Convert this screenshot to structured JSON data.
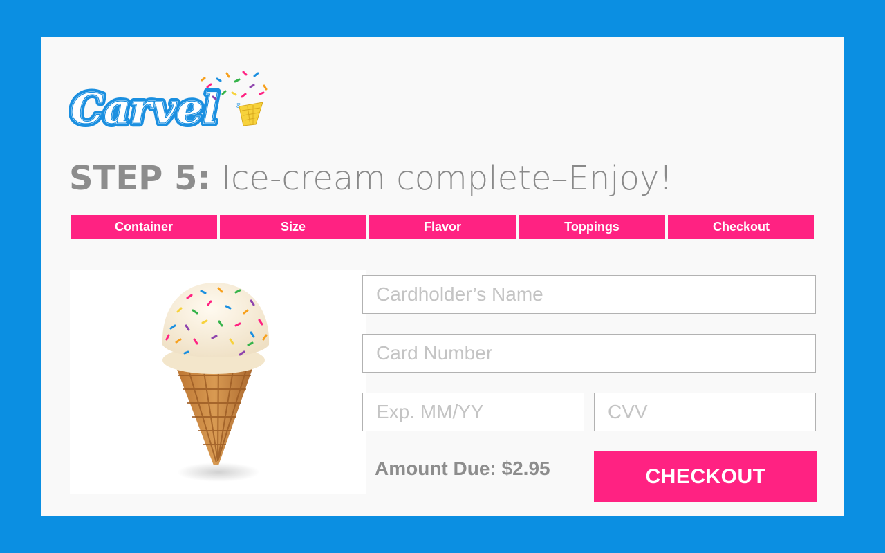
{
  "brand": {
    "name": "Carvel",
    "registered_mark": "®",
    "colors": {
      "background": "#0b8fe2",
      "panel": "#f9f9f9",
      "accent": "#ff2282",
      "logo_blue": "#1a8fe0",
      "cone_yellow": "#f7d23c"
    }
  },
  "step": {
    "label": "STEP 5:",
    "description": "Ice-cream complete–Enjoy!"
  },
  "tabs": [
    {
      "label": "Container"
    },
    {
      "label": "Size"
    },
    {
      "label": "Flavor"
    },
    {
      "label": "Toppings"
    },
    {
      "label": "Checkout"
    }
  ],
  "product_image": {
    "icon": "ice-cream-cone-with-sprinkles"
  },
  "payment_form": {
    "cardholder_name": {
      "placeholder": "Cardholder’s Name",
      "value": ""
    },
    "card_number": {
      "placeholder": "Card Number",
      "value": ""
    },
    "expiry": {
      "placeholder": "Exp. MM/YY",
      "value": ""
    },
    "cvv": {
      "placeholder": "CVV",
      "value": ""
    }
  },
  "amount_due": "Amount Due: $2.95",
  "checkout_button": "CHECKOUT"
}
